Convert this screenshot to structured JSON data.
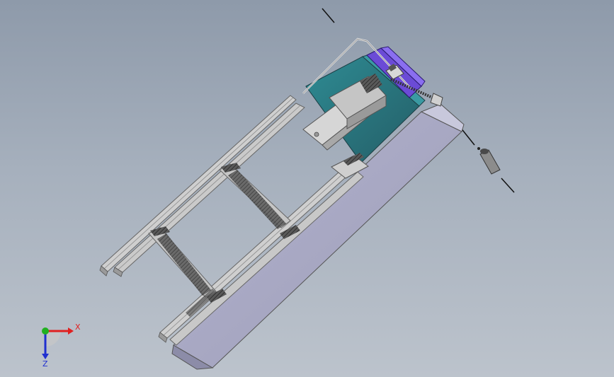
{
  "viewport": {
    "background_top": "#8e9aaa",
    "background_bottom": "#bcc3cc"
  },
  "model": {
    "rail_color": "#c9c9c9",
    "rail_edge_color": "#6d6d6d",
    "base_color": "#a9a9c4",
    "motor_color": "#2f7e86",
    "motor_top_color": "#6b4bd6",
    "bracket_color": "#d3d3d3",
    "hatch_color": "#3a3a3a"
  },
  "triad": {
    "x_label": "X",
    "z_label": "Z",
    "x_color": "#e02020",
    "y_color": "#20b020",
    "z_color": "#2030d0"
  }
}
